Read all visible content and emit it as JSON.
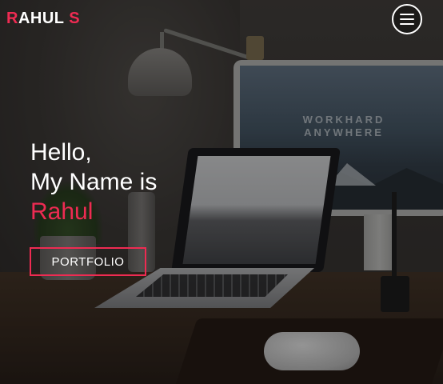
{
  "header": {
    "logo_first": "R",
    "logo_rest": "AHUL ",
    "logo_last": "S",
    "menu_icon": "hamburger-menu-icon"
  },
  "hero": {
    "line1": "Hello,",
    "line2": "My Name is",
    "name": "Rahul",
    "button_label": "PORTFOLIO"
  },
  "background_screen": {
    "text_line1": "WORKHARD",
    "text_line2": "ANYWHERE"
  },
  "colors": {
    "accent": "#ee2b52",
    "text": "#ffffff",
    "overlay": "rgba(0,0,0,0.42)"
  }
}
